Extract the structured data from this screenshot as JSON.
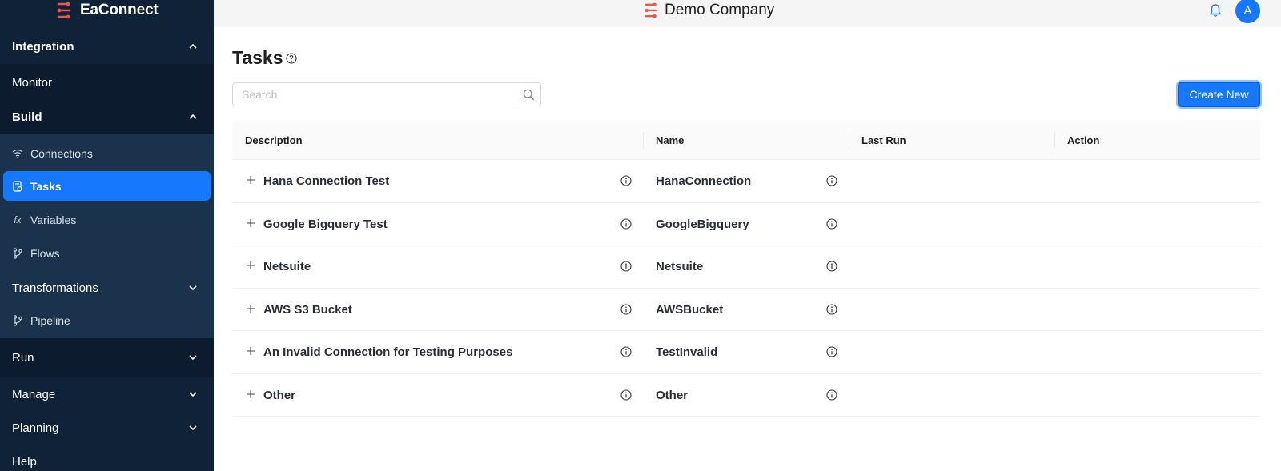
{
  "sidebar": {
    "logo_text": "EaConnect",
    "integration_label": "Integration",
    "monitor_label": "Monitor",
    "build_label": "Build",
    "build_items": [
      {
        "label": "Connections",
        "icon": "wifi-icon"
      },
      {
        "label": "Tasks",
        "icon": "task-icon",
        "active": true
      },
      {
        "label": "Variables",
        "icon": "fx-icon",
        "glyph": "fx"
      },
      {
        "label": "Flows",
        "icon": "branch-icon"
      }
    ],
    "transformations_label": "Transformations",
    "pipeline_label": "Pipeline",
    "run_label": "Run",
    "manage_label": "Manage",
    "planning_label": "Planning",
    "help_label": "Help"
  },
  "topbar": {
    "company_name": "Demo Company",
    "avatar_initial": "A"
  },
  "main": {
    "title": "Tasks",
    "search_placeholder": "Search",
    "create_button": "Create New",
    "columns": [
      "Description",
      "Name",
      "Last Run",
      "Action"
    ],
    "rows": [
      {
        "description": "Hana Connection Test",
        "name": "HanaConnection"
      },
      {
        "description": "Google Bigquery Test",
        "name": "GoogleBigquery"
      },
      {
        "description": "Netsuite",
        "name": "Netsuite"
      },
      {
        "description": "AWS S3 Bucket",
        "name": "AWSBucket"
      },
      {
        "description": "An Invalid Connection for Testing Purposes",
        "name": "TestInvalid"
      },
      {
        "description": "Other",
        "name": "Other"
      }
    ]
  },
  "colors": {
    "sidebar_bg": "#0f2238",
    "accent": "#1677ff",
    "brand": "#f0544f"
  }
}
